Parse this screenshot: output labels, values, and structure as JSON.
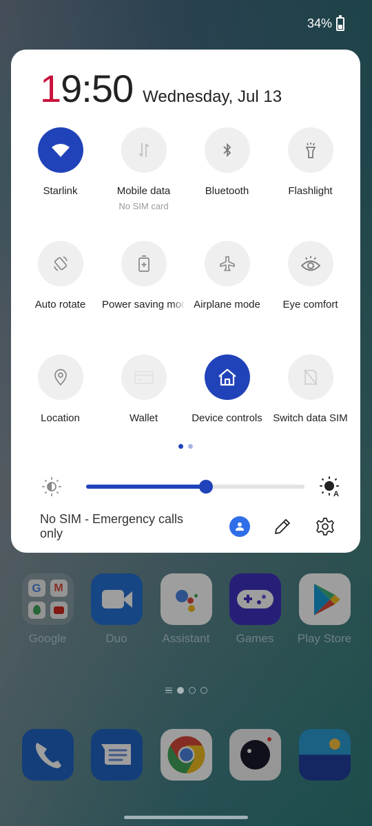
{
  "status_bar": {
    "battery_percent_label": "34%",
    "battery_level": 0.34,
    "battery_icon": "battery-icon"
  },
  "quick_settings": {
    "clock": {
      "first_digit": "1",
      "rest": "9:50"
    },
    "date": "Wednesday, Jul 13",
    "accent_color": "#2143b9",
    "tiles": [
      {
        "label": "Starlink",
        "icon": "wifi-icon",
        "active": true
      },
      {
        "label": "Mobile data",
        "sublabel": "No SIM card",
        "icon": "mobile-data-icon",
        "active": false
      },
      {
        "label": "Bluetooth",
        "icon": "bluetooth-icon",
        "active": false
      },
      {
        "label": "Flashlight",
        "icon": "flashlight-icon",
        "active": false
      },
      {
        "label": "Auto rotate",
        "icon": "auto-rotate-icon",
        "active": false
      },
      {
        "label": "Power saving mode",
        "icon": "battery-saver-icon",
        "active": false
      },
      {
        "label": "Airplane mode",
        "icon": "airplane-icon",
        "active": false
      },
      {
        "label": "Eye comfort",
        "icon": "eye-icon",
        "active": false
      },
      {
        "label": "Location",
        "icon": "location-pin-icon",
        "active": false
      },
      {
        "label": "Wallet",
        "icon": "wallet-card-icon",
        "active": false
      },
      {
        "label": "Device controls",
        "icon": "home-icon",
        "active": true
      },
      {
        "label": "Switch data SIM",
        "icon": "sim-off-icon",
        "active": false
      }
    ],
    "page_indicator": {
      "current": 1,
      "total": 2
    },
    "brightness": {
      "level": 0.55,
      "low_icon": "brightness-low-icon",
      "auto_icon": "brightness-auto-icon"
    },
    "footer": {
      "sim_status": "No SIM - Emergency calls only",
      "user_icon": "user-icon",
      "edit_icon": "pencil-icon",
      "settings_icon": "gear-icon"
    }
  },
  "home_screen": {
    "apps": [
      {
        "name": "Google",
        "icon": "google-folder-icon"
      },
      {
        "name": "Duo",
        "icon": "duo-video-icon"
      },
      {
        "name": "Assistant",
        "icon": "assistant-icon"
      },
      {
        "name": "Games",
        "icon": "gamepad-icon"
      },
      {
        "name": "Play Store",
        "icon": "play-store-icon"
      }
    ],
    "page_indicator": {
      "current": 1,
      "total": 3
    },
    "dock": [
      {
        "icon": "phone-icon"
      },
      {
        "icon": "messages-icon"
      },
      {
        "icon": "chrome-icon"
      },
      {
        "icon": "camera-icon"
      },
      {
        "icon": "gallery-icon"
      }
    ]
  }
}
